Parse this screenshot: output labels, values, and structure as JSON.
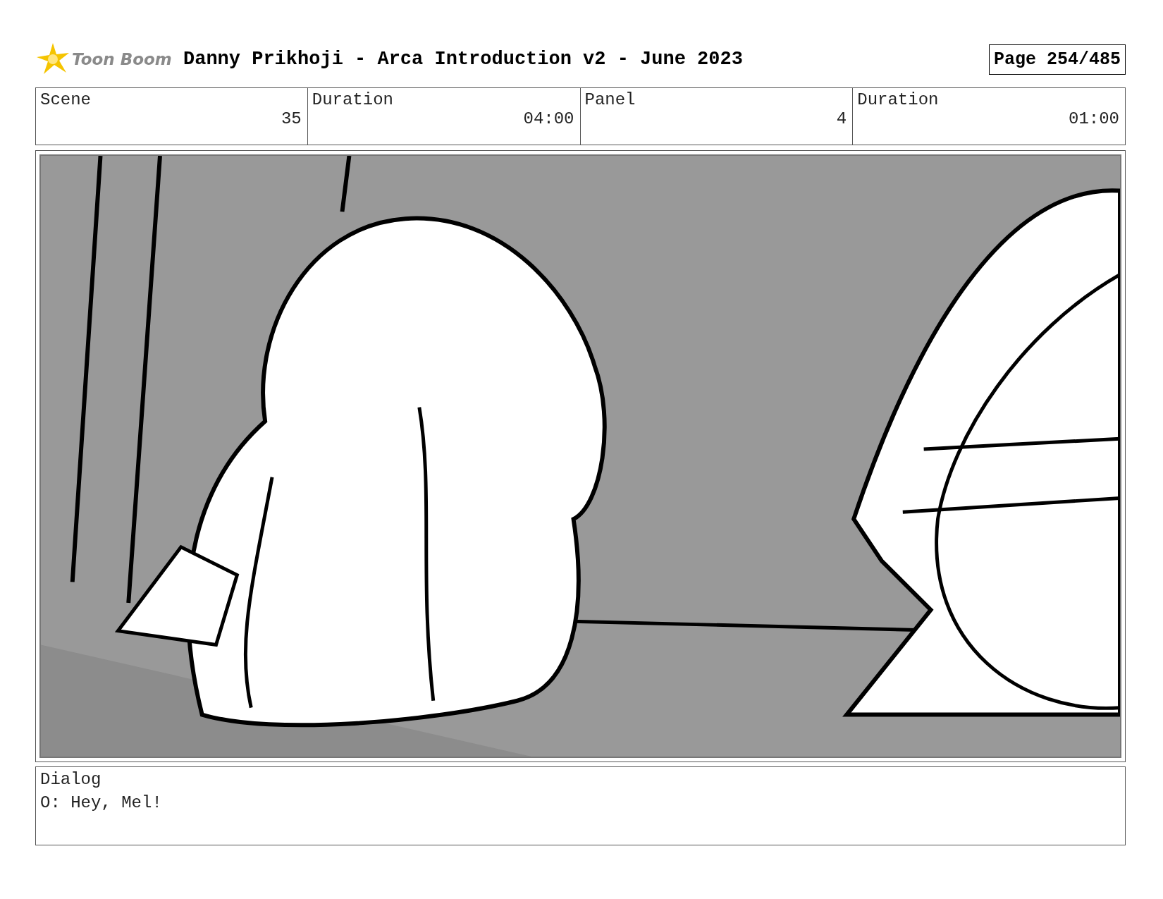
{
  "header": {
    "logo_text": "Toon Boom",
    "title": "Danny Prikhoji - Arca Introduction v2 - June 2023",
    "page": "Page 254/485"
  },
  "info_table": {
    "headings": [
      "Scene",
      "Duration",
      "Panel",
      "Duration"
    ],
    "cells": [
      "35",
      "04:00",
      "4",
      "01:00"
    ]
  },
  "dialog": {
    "label": "Dialog",
    "text": "O: Hey, Mel!"
  }
}
